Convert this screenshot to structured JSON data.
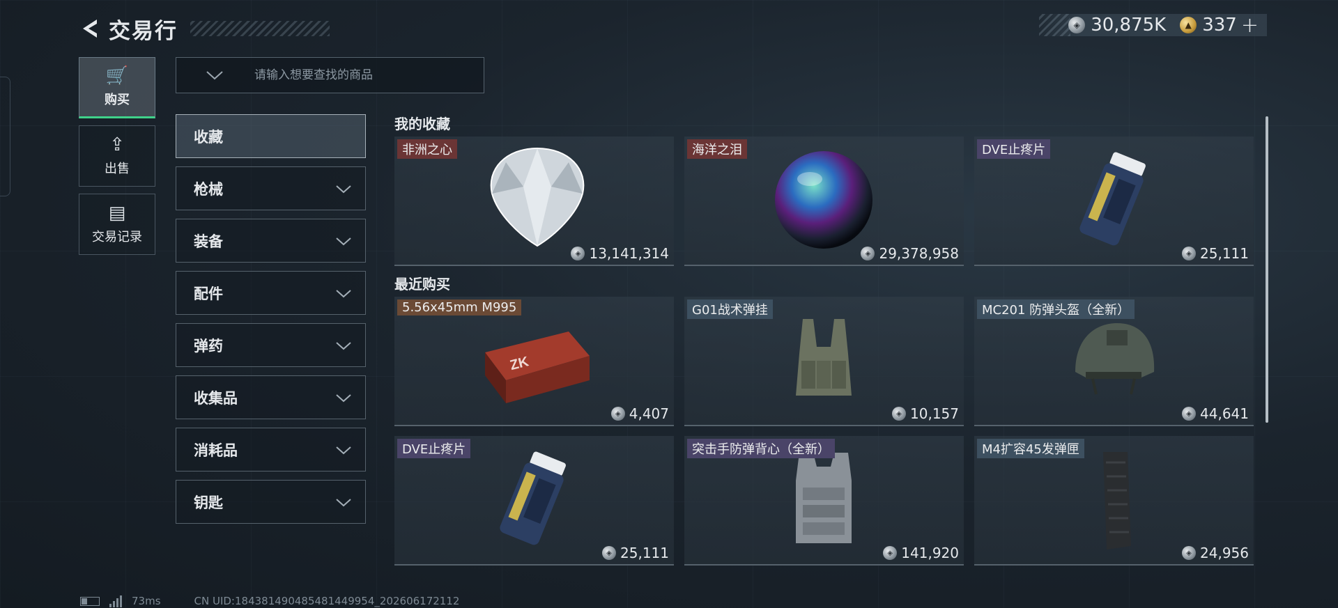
{
  "header": {
    "title": "交易行"
  },
  "currency": {
    "silver": "30,875K",
    "gold": "337",
    "plus": "+"
  },
  "nav": [
    {
      "label": "购买",
      "icon": "cart-icon",
      "glyph": "🛒",
      "active": true
    },
    {
      "label": "出售",
      "icon": "sell-cart-icon",
      "glyph": "⇪",
      "active": false
    },
    {
      "label": "交易记录",
      "icon": "record-icon",
      "glyph": "▤",
      "active": false
    }
  ],
  "search": {
    "placeholder": "请输入想要查找的商品"
  },
  "categories": [
    "收藏",
    "枪械",
    "装备",
    "配件",
    "弹药",
    "收集品",
    "消耗品",
    "钥匙"
  ],
  "sections": [
    {
      "title": "我的收藏",
      "items": [
        {
          "name": "非洲之心",
          "price": "13,141,314",
          "tag_color": "#6b3535",
          "art": "diamond"
        },
        {
          "name": "海洋之泪",
          "price": "29,378,958",
          "tag_color": "#6b3535",
          "art": "pearl"
        },
        {
          "name": "DVE止疼片",
          "price": "25,111",
          "tag_color": "#4a4468",
          "art": "pills"
        }
      ]
    },
    {
      "title": "最近购买",
      "items": [
        {
          "name": "5.56x45mm M995",
          "price": "4,407",
          "tag_color": "#6b4a35",
          "art": "ammo"
        },
        {
          "name": "G01战术弹挂",
          "price": "10,157",
          "tag_color": "#3d5060",
          "art": "rig"
        },
        {
          "name": "MC201 防弹头盔（全新）",
          "price": "44,641",
          "tag_color": "#3d5060",
          "art": "helmet"
        },
        {
          "name": "DVE止疼片",
          "price": "25,111",
          "tag_color": "#4a4468",
          "art": "pills"
        },
        {
          "name": "突击手防弹背心（全新）",
          "price": "141,920",
          "tag_color": "#4a4468",
          "art": "vest"
        },
        {
          "name": "M4扩容45发弹匣",
          "price": "24,956",
          "tag_color": "#3d5060",
          "art": "mag"
        }
      ]
    }
  ],
  "footer": {
    "ping": "73ms",
    "uid": "CN UID:184381490485481449954_202606172112"
  }
}
